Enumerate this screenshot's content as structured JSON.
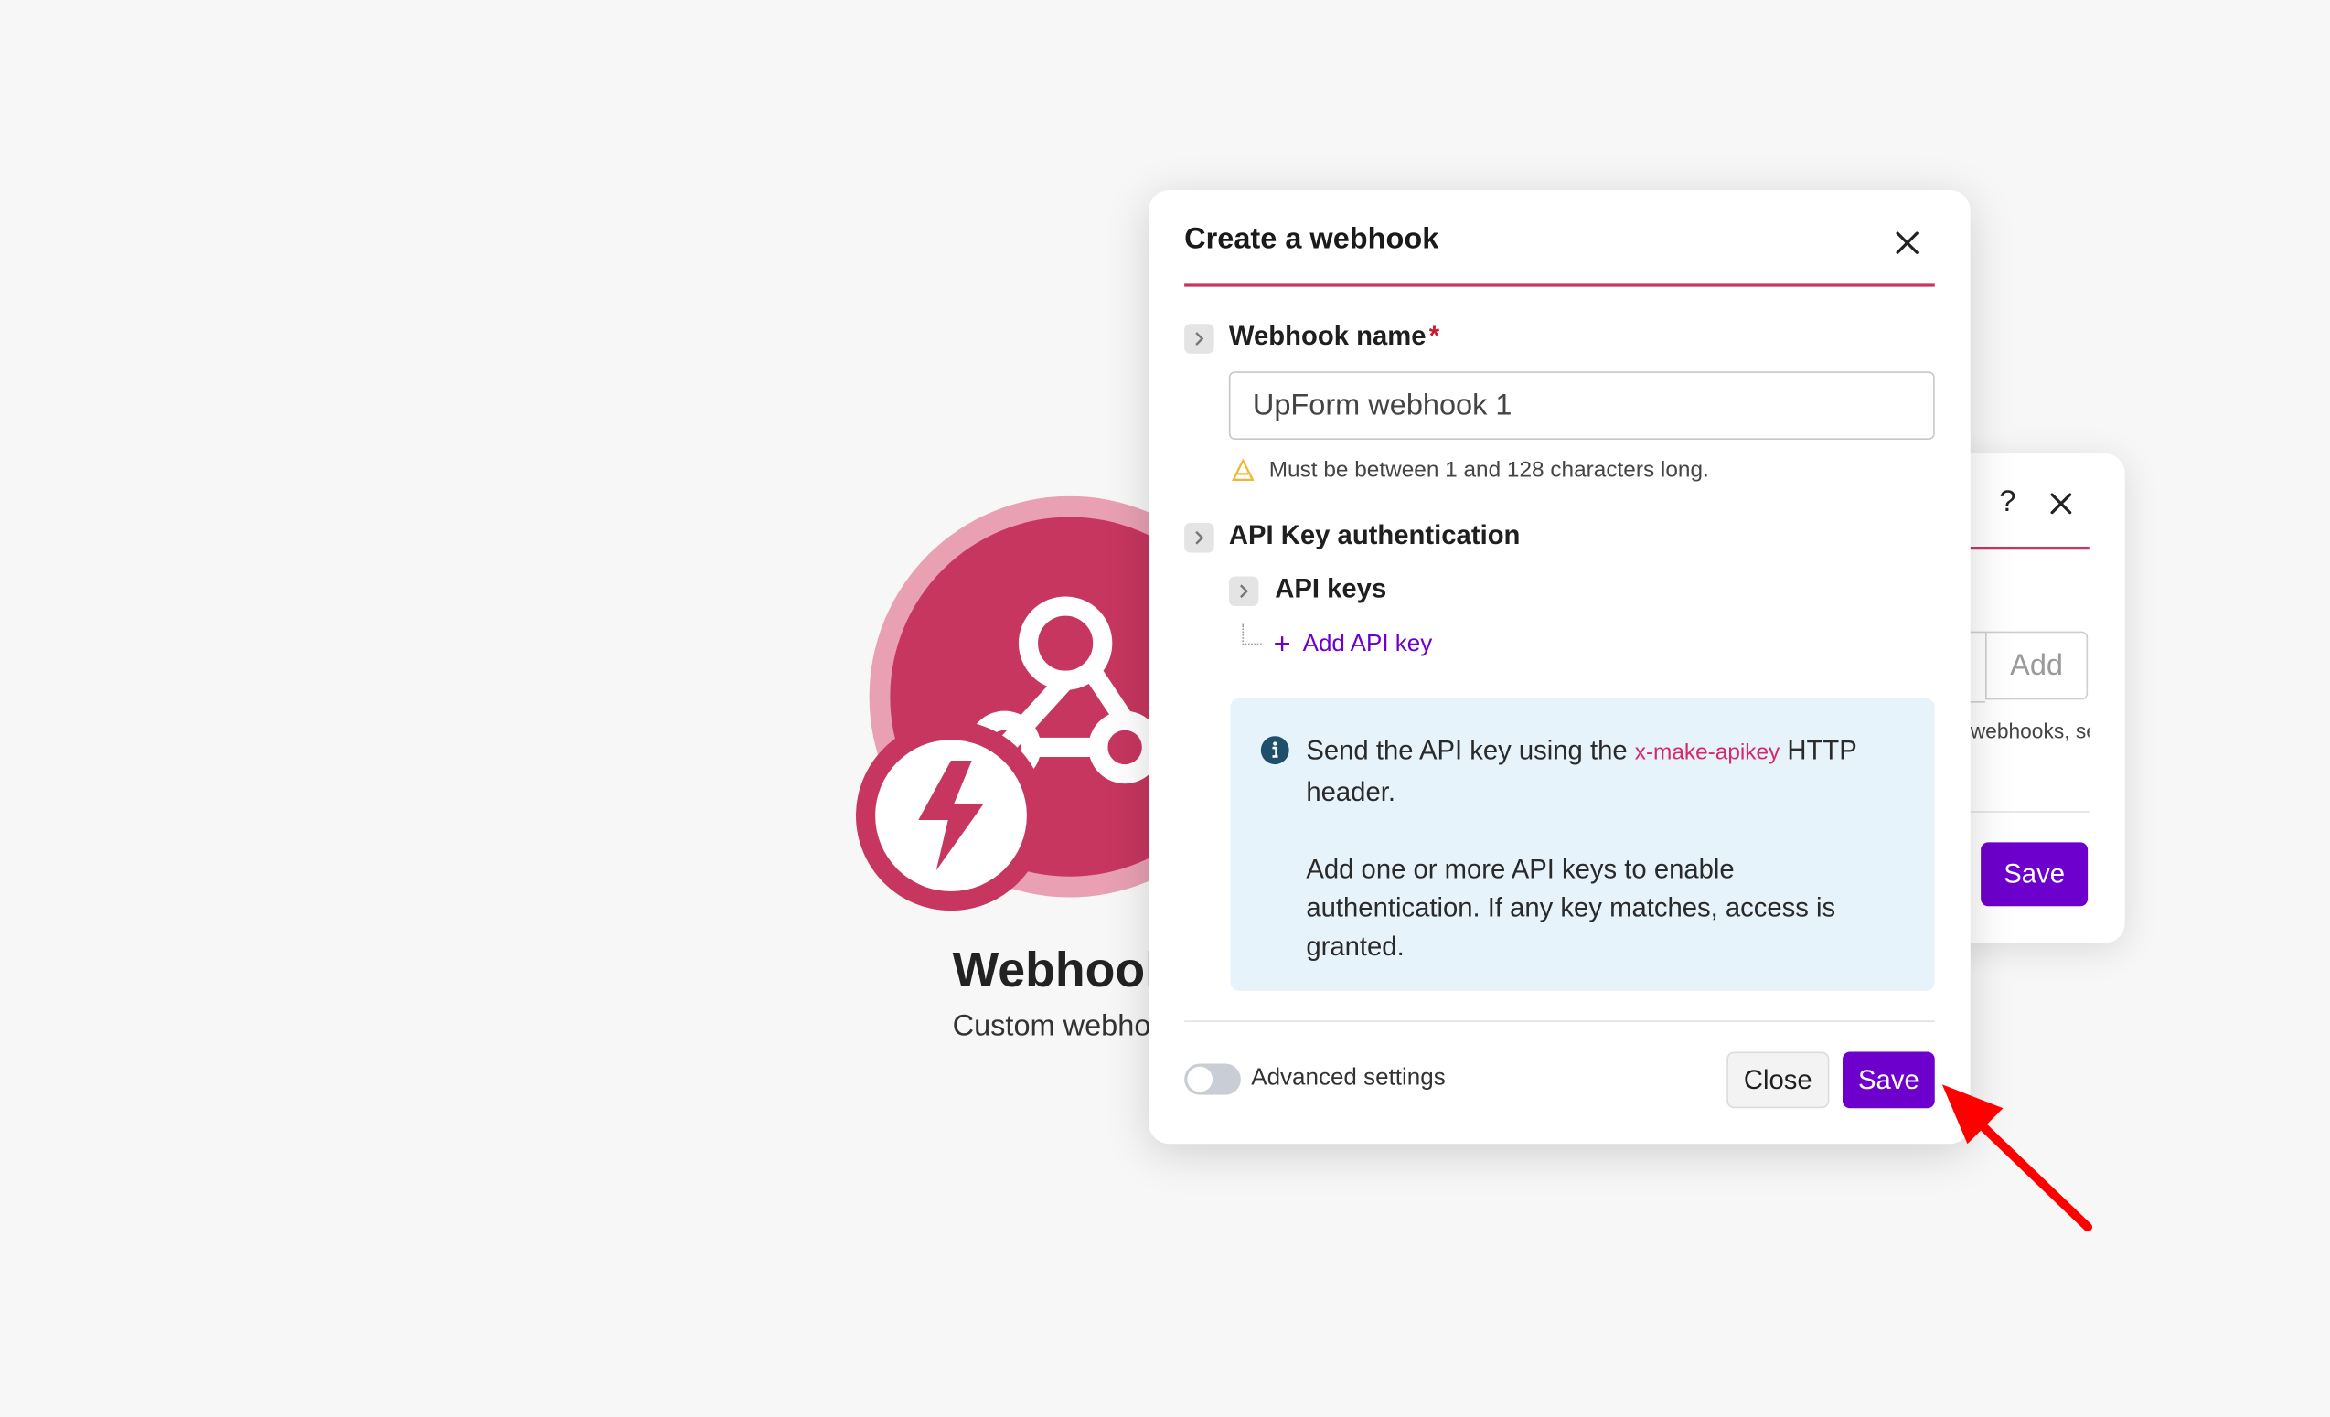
{
  "module": {
    "title": "Webhooks",
    "subtitle": "Custom webhook"
  },
  "back_dialog": {
    "help_label": "?",
    "add_button": "Add",
    "help_text": "webhooks, see",
    "save_label": "Save"
  },
  "dialog": {
    "title": "Create a webhook",
    "webhook_name": {
      "label": "Webhook name",
      "required_mark": "*",
      "value": "UpForm webhook 1",
      "hint": "Must be between 1 and 128 characters long."
    },
    "api_key_auth": {
      "label": "API Key authentication",
      "api_keys_label": "API keys",
      "add_api_key": "Add API key"
    },
    "info": {
      "line1_before": "Send the API key using the ",
      "header_code": "x-make-apikey",
      "line1_after": " HTTP header.",
      "line2": "Add one or more API keys to enable authentication. If any key matches, access is granted."
    },
    "footer": {
      "advanced_settings": "Advanced settings",
      "advanced_enabled": false,
      "close_label": "Close",
      "save_label": "Save"
    }
  },
  "colors": {
    "brand": "#c7365f",
    "primary_button": "#6d00cc",
    "info_background": "#e6f3fb",
    "annotation_arrow": "#ff0000"
  },
  "icons": {
    "module": "webhook-icon",
    "badge": "lightning-icon",
    "close": "close-icon",
    "help": "help-icon",
    "chevron": "chevron-right-icon",
    "warning": "warning-icon",
    "info": "info-icon",
    "add": "plus-icon"
  }
}
